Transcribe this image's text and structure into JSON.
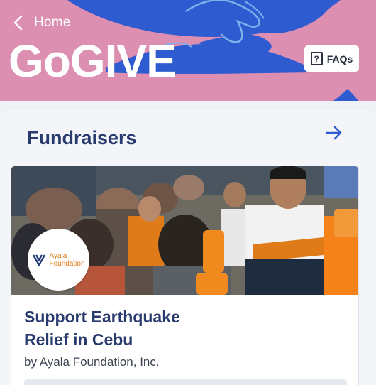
{
  "header": {
    "back_label": "Home",
    "brand": "GoGIVE",
    "faq_label": "FAQs",
    "faq_icon_glyph": "?",
    "background_color": "#dc8fb1",
    "art_color": "#2f5bd0"
  },
  "section": {
    "title": "Fundraisers",
    "title_color": "#283a6e"
  },
  "fundraiser": {
    "title_line1": "Support Earthquake",
    "title_line2": "Relief in Cebu",
    "org": "by Ayala Foundation, Inc.",
    "logo_line1": "Ayala",
    "logo_line2": "Foundation",
    "logo_color": "#e07b1a"
  },
  "icons": {
    "back": "chevron-left-icon",
    "faq": "question-box-icon",
    "arrow": "arrow-right-icon",
    "logo": "ayala-foundation-logo"
  }
}
